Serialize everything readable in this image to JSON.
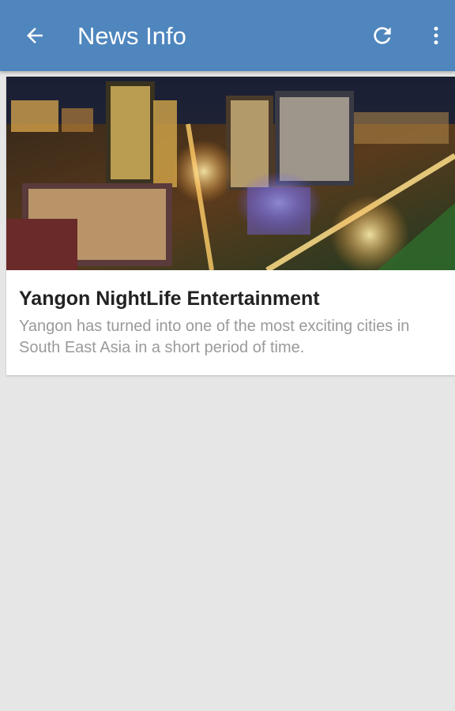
{
  "app_bar": {
    "title": "News Info",
    "background": "#4f86bd",
    "icons": [
      "back-arrow-icon",
      "refresh-icon",
      "more-vert-icon"
    ]
  },
  "news": [
    {
      "title": "Yangon NightLife Entertainment",
      "summary": "Yangon has turned into one of the most exciting cities in South East Asia in a short period of time."
    }
  ]
}
